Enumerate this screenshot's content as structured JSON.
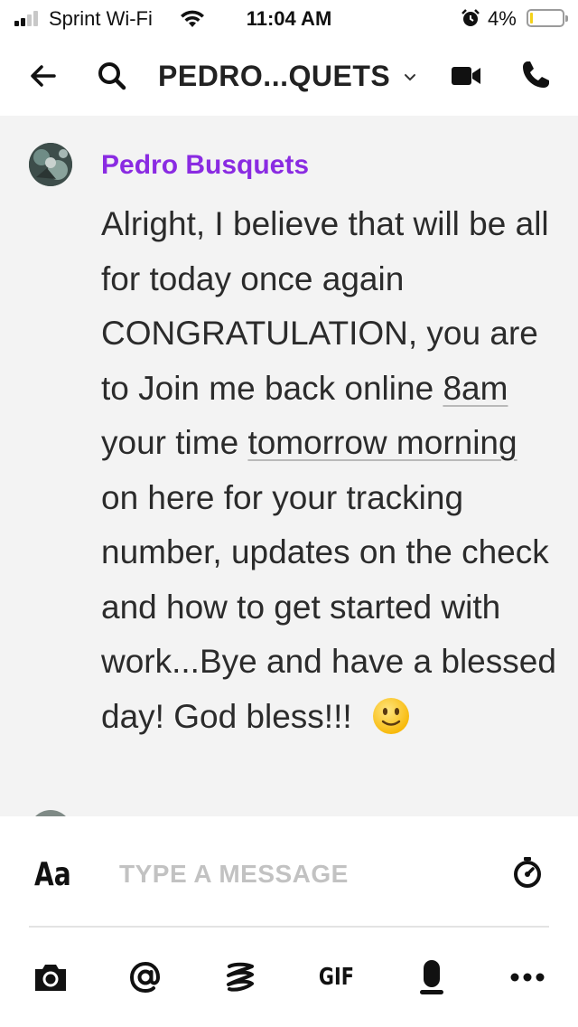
{
  "status_bar": {
    "carrier": "Sprint Wi-Fi",
    "time": "11:04 AM",
    "battery_percent": "4%",
    "battery_level": 0.04,
    "signal_bars": 2,
    "battery_color": "#f4d21a"
  },
  "header": {
    "title": "PEDRO...QUETS",
    "icons": [
      "back-arrow-icon",
      "search-icon",
      "chevron-down-icon",
      "video-call-icon",
      "phone-call-icon"
    ]
  },
  "chat": {
    "sender": "Pedro Busquets",
    "sender_color": "#8a2be2",
    "message": {
      "part1": "Alright, I believe that will be all for today once again CONGRATULATION, you are to Join me back online ",
      "link1": "8am",
      "part2": " your time ",
      "link2": "tomorrow morning",
      "part3": " on here for your tracking number, updates on the check and how to get started with work...Bye and have a blessed day! God bless!!!",
      "emoji": "slightly-smiling-face"
    }
  },
  "composer": {
    "format_label": "Aa",
    "placeholder": "TYPE A MESSAGE",
    "gif_label": "GIF",
    "tools": [
      "camera-icon",
      "mention-icon",
      "sticker-icon",
      "gif-button",
      "microphone-icon",
      "more-icon"
    ]
  }
}
